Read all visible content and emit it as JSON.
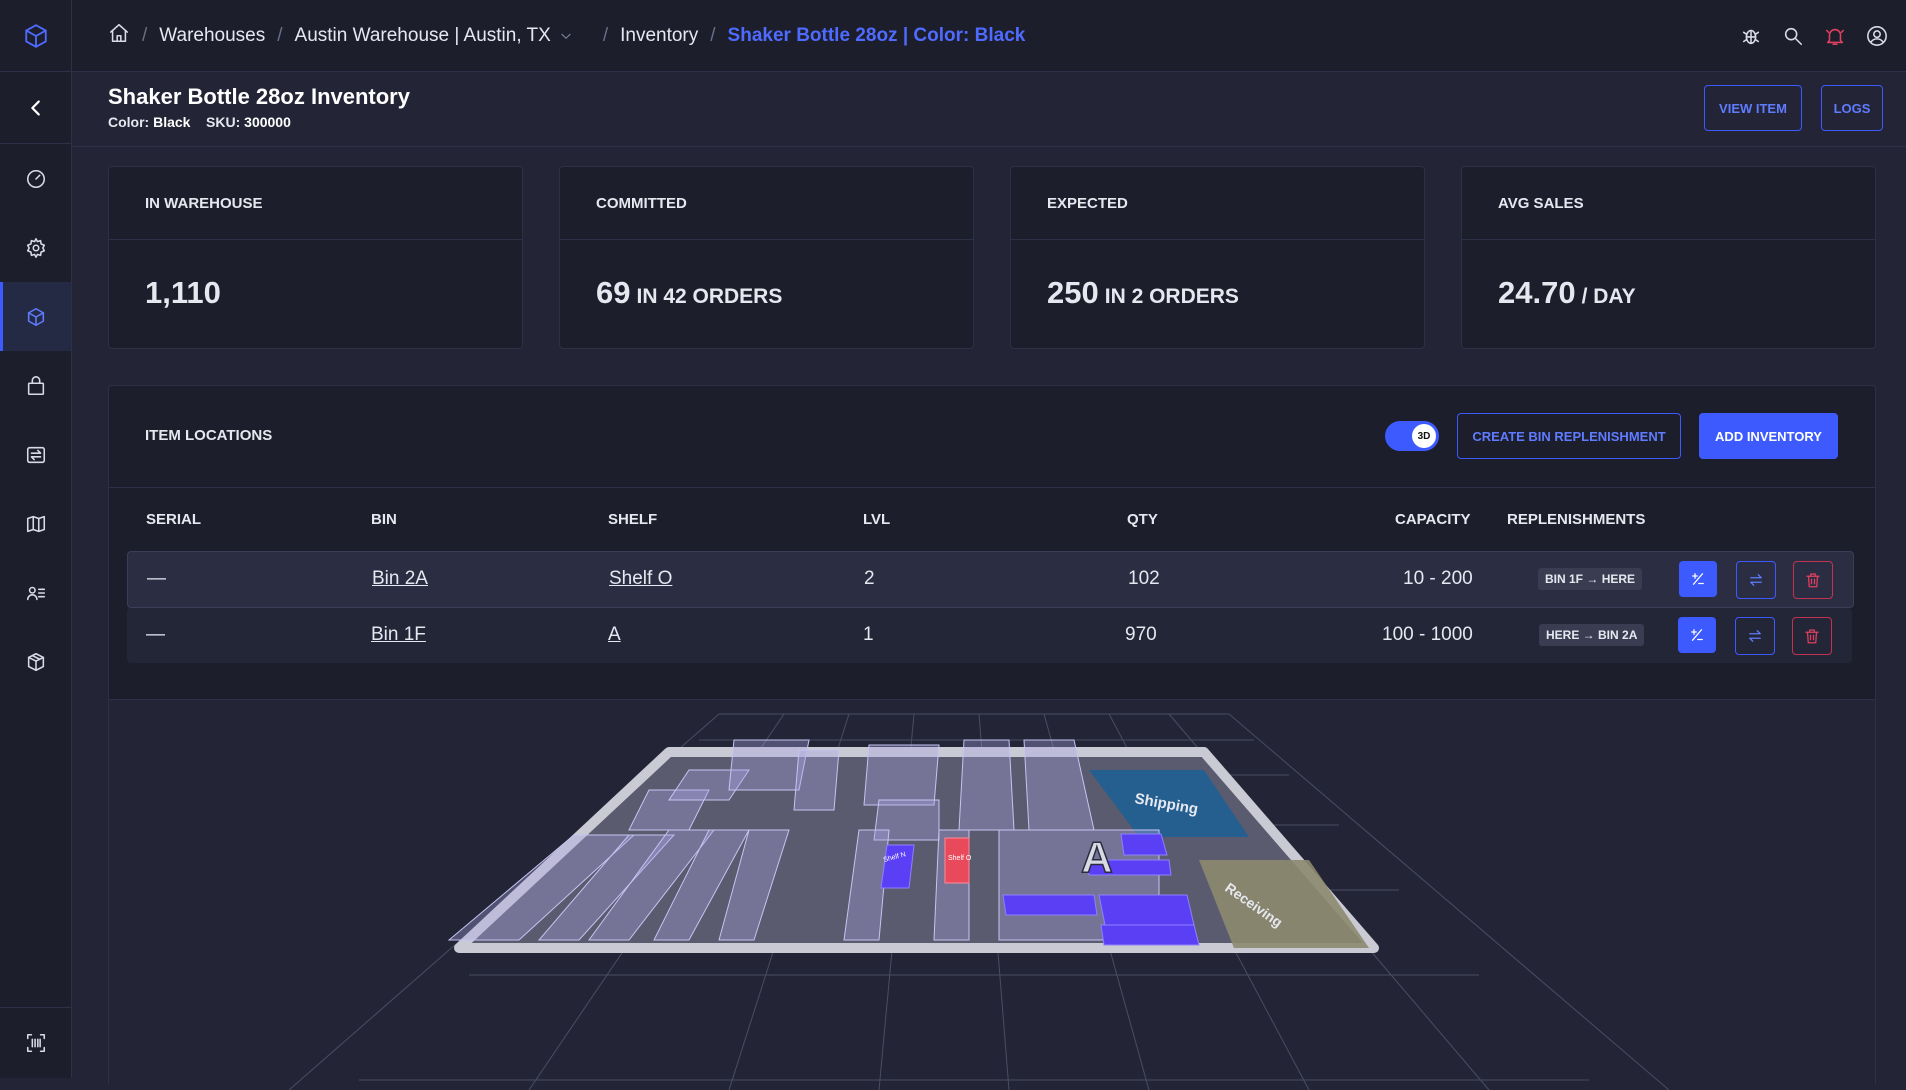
{
  "breadcrumb": {
    "warehouses": "Warehouses",
    "warehouse": "Austin Warehouse | Austin, TX",
    "inventory": "Inventory",
    "current": "Shaker Bottle 28oz | Color: Black"
  },
  "header": {
    "title": "Shaker Bottle 28oz Inventory",
    "color_label": "Color:",
    "color_value": "Black",
    "sku_label": "SKU:",
    "sku_value": "300000",
    "view_item": "VIEW ITEM",
    "logs": "LOGS"
  },
  "stats": [
    {
      "label": "IN WAREHOUSE",
      "value": "1,110",
      "suffix": ""
    },
    {
      "label": "COMMITTED",
      "value": "69",
      "suffix": "IN 42 ORDERS"
    },
    {
      "label": "EXPECTED",
      "value": "250",
      "suffix": "IN 2 ORDERS"
    },
    {
      "label": "AVG SALES",
      "value": "24.70",
      "suffix": "/ DAY"
    }
  ],
  "locations": {
    "title": "ITEM LOCATIONS",
    "toggle_label": "3D",
    "create_bin": "CREATE BIN REPLENISHMENT",
    "add_inventory": "ADD INVENTORY",
    "columns": [
      "SERIAL",
      "BIN",
      "SHELF",
      "LVL",
      "QTY",
      "CAPACITY",
      "REPLENISHMENTS"
    ],
    "rows": [
      {
        "serial": "—",
        "bin": "Bin 2A",
        "shelf": "Shelf O",
        "lvl": "2",
        "qty": "102",
        "capacity": "10 - 200",
        "repl_from": "BIN 1F",
        "repl_to": "HERE"
      },
      {
        "serial": "—",
        "bin": "Bin 1F",
        "shelf": "A",
        "lvl": "1",
        "qty": "970",
        "capacity": "100 - 1000",
        "repl_from": "HERE",
        "repl_to": "BIN 2A"
      }
    ]
  },
  "map3d": {
    "shipping": "Shipping",
    "receiving": "Receiving",
    "zone_a": "A",
    "shelf_n": "Shelf N",
    "shelf_o": "Shelf O"
  },
  "colors": {
    "accent": "#3d5afe",
    "bg": "#232536",
    "panel": "#1c1e2c",
    "danger": "#c23350"
  }
}
